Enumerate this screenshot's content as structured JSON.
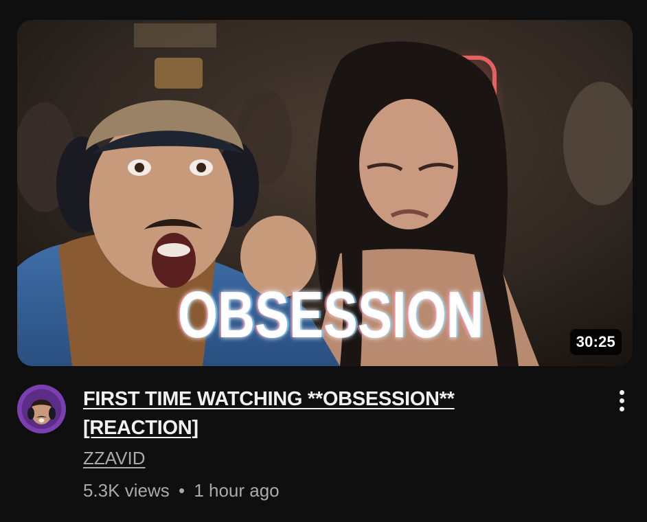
{
  "video": {
    "title": "FIRST TIME WATCHING **OBSESSION** [REACTION]",
    "channel": "ZZAVID",
    "views": "5.3K views",
    "separator": "•",
    "age": "1 hour ago",
    "duration": "30:25",
    "thumbnail_text": "OBSESSION"
  },
  "icons": {
    "more": "vertical-dots-icon"
  },
  "colors": {
    "background": "#0f0f0f",
    "title": "#f1f1f1",
    "secondary": "#aaaaaa",
    "avatar_ring": "#7a3fb0"
  }
}
